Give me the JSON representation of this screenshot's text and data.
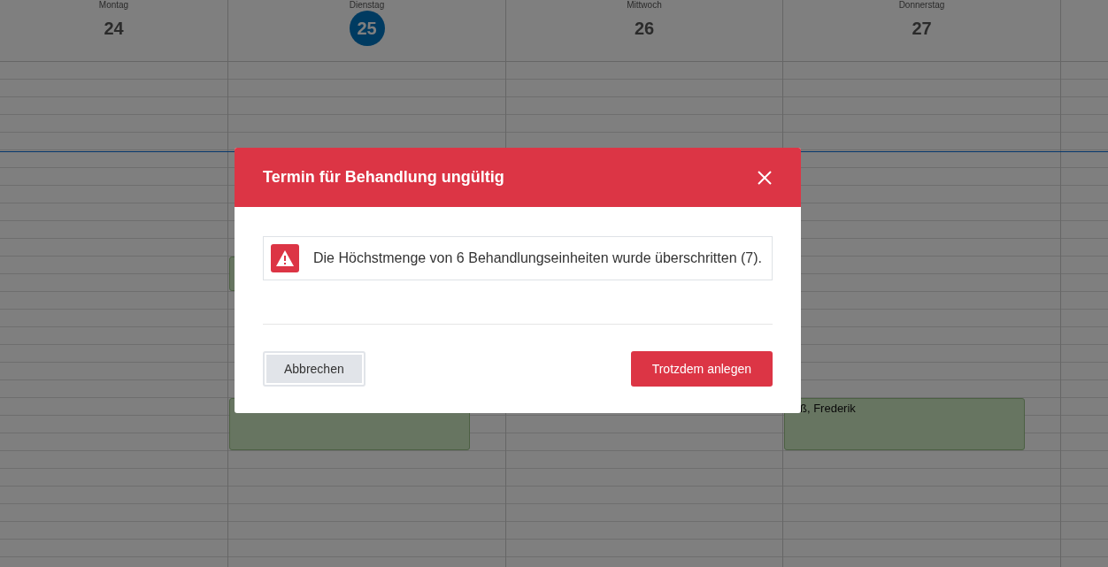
{
  "calendar": {
    "days": [
      {
        "name": "Montag",
        "date": "24",
        "today": false
      },
      {
        "name": "Dienstag",
        "date": "25",
        "today": true,
        "events": [
          {
            "kind": "appointment"
          },
          {
            "kind": "appointment"
          }
        ]
      },
      {
        "name": "Mittwoch",
        "date": "26",
        "today": false
      },
      {
        "name": "Donnerstag",
        "date": "27",
        "today": false,
        "events": [
          {
            "kind": "appointment",
            "text": "ß, Frederik"
          }
        ]
      }
    ]
  },
  "dialog": {
    "title": "Termin für Behandlung ungültig",
    "alert": {
      "kind": "error",
      "message": "Die Höchstmenge von 6 Behandlungseinheiten wurde überschritten (7)."
    },
    "buttons": [
      {
        "label": "Abbrechen",
        "kind": "secondary",
        "focused": true
      },
      {
        "label": "Trotzdem anlegen",
        "kind": "primary",
        "focused": false
      }
    ]
  }
}
